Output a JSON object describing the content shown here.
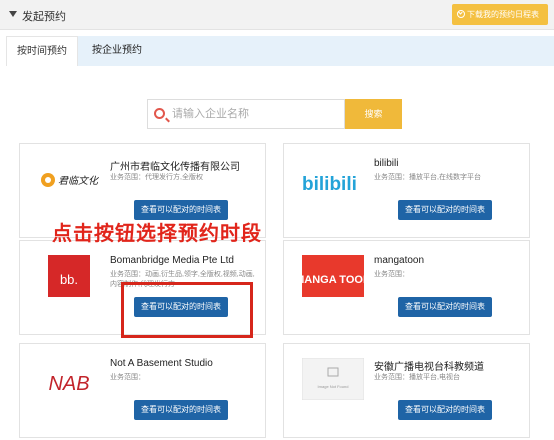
{
  "header": {
    "title": "发起预约",
    "download_label": "下载我的预约日程表"
  },
  "tabs": [
    {
      "label": "按时间预约",
      "active": false
    },
    {
      "label": "按企业预约",
      "active": true
    }
  ],
  "search": {
    "placeholder": "请输入企业名称",
    "button_label": "搜索"
  },
  "annotation": "点击按钮选择预约时段",
  "companies": [
    {
      "name": "广州市君临文化传播有限公司",
      "scope": "业务范围：代理发行方,全版权",
      "button": "查看可以配对的时间表",
      "logo_text": "君临文化"
    },
    {
      "name": "bilibili",
      "scope": "业务范围：播放平台,在线数字平台",
      "button": "查看可以配对的时间表",
      "logo_text": "bilibili"
    },
    {
      "name": "Bomanbridge Media Pte Ltd",
      "scope": "业务范围：动画,衍生品,领字,全版权,视频,动画,内容制作,代理发行方",
      "button": "查看可以配对的时间表",
      "logo_text": "bb."
    },
    {
      "name": "mangatoon",
      "scope": "业务范围：",
      "button": "查看可以配对的时间表",
      "logo_text": "MANGA TOON"
    },
    {
      "name": "Not A Basement Studio",
      "scope": "业务范围：",
      "button": "查看可以配对的时间表",
      "logo_text": "NAB"
    },
    {
      "name": "安徽广播电视台科教频道",
      "scope": "业务范围：播放平台,电视台",
      "button": "查看可以配对的时间表",
      "logo_text": "Image Not Found"
    }
  ],
  "colors": {
    "accent_yellow": "#f0b93a",
    "button_blue": "#1f64a6",
    "tab_bg": "#e6f1fa",
    "annotation_red": "#e1251b"
  }
}
